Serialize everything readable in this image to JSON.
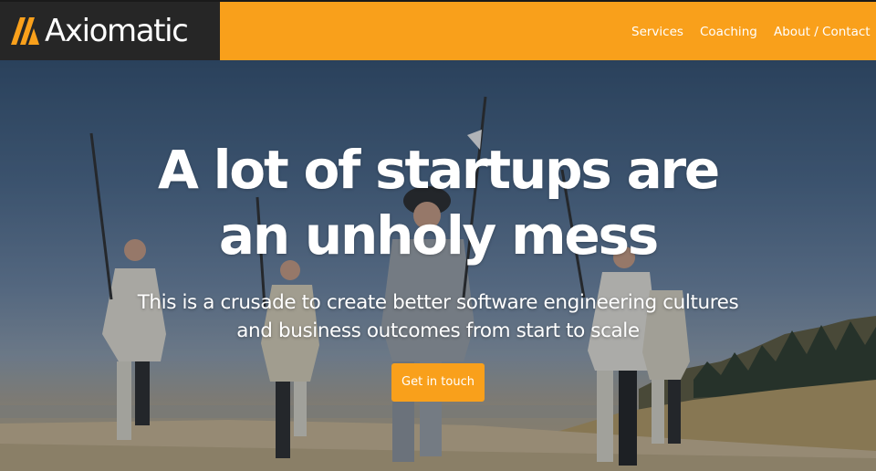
{
  "brand": {
    "name": "Axiomatic",
    "logo_icon": "double-slash-triangle-icon"
  },
  "nav": {
    "items": [
      {
        "label": "Services"
      },
      {
        "label": "Coaching"
      },
      {
        "label": "About / Contact"
      }
    ]
  },
  "hero": {
    "headline_line1": "A lot of startups are",
    "headline_line2": "an unholy mess",
    "subheading_line1": "This is a crusade to create better software engineering cultures",
    "subheading_line2": "and business outcomes from start to scale",
    "cta_label": "Get in touch",
    "background_image": "crusaders-charging-on-beach-photo"
  },
  "colors": {
    "accent": "#f9a01b",
    "logo_background": "#262626",
    "text_on_dark": "#ffffff"
  }
}
